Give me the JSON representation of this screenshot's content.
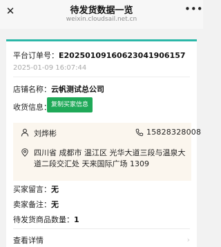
{
  "header": {
    "title": "待发货数据一览",
    "url": "weixin.cloudsail.net.cn"
  },
  "order": {
    "label": "平台订单号：",
    "number": "E20250109160623041906157",
    "datetime": "2025-01-09 16:07:44"
  },
  "store": {
    "label": "店铺名称：",
    "name": "云帆测试总公司"
  },
  "receiver": {
    "label": "收货信息：",
    "copy_button": "复制买家信息",
    "name": "刘烨彬",
    "phone": "15828328008",
    "address": "四川省 成都市 温江区 光华大道三段与温泉大道二段交汇处 天来国际广场 1309"
  },
  "buyer_message": {
    "label": "买家留言：",
    "value": "无"
  },
  "seller_note": {
    "label": "卖家备注：",
    "value": "无"
  },
  "quantity": {
    "label": "待发货商品数量：",
    "value": "1"
  },
  "detail_link": "查看详情"
}
